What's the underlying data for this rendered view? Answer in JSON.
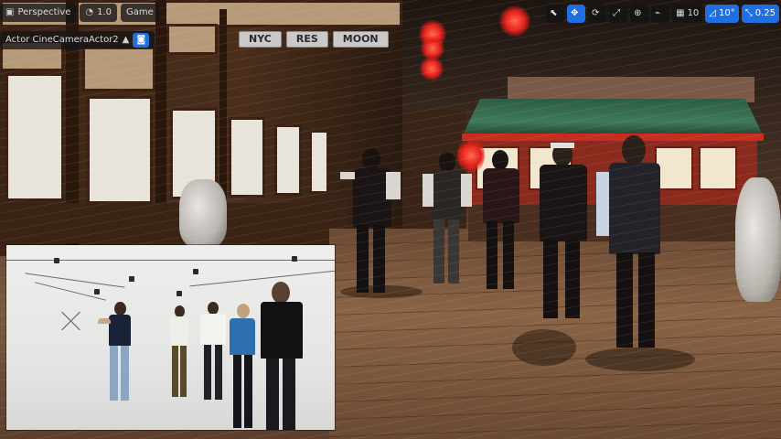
{
  "toolbar": {
    "view_mode_label": "Perspective",
    "camera_speed_label": "1.0",
    "lighting_label": "Game",
    "actor_label": "Actor CineCameraActor2",
    "right_tools": [
      {
        "name": "select-icon",
        "glyph": "⬉",
        "active": false,
        "value": ""
      },
      {
        "name": "translate-icon",
        "glyph": "✥",
        "active": true,
        "value": ""
      },
      {
        "name": "rotate-icon",
        "glyph": "⟳",
        "active": false,
        "value": ""
      },
      {
        "name": "scale-icon",
        "glyph": "⤢",
        "active": false,
        "value": ""
      },
      {
        "name": "world-icon",
        "glyph": "⊕",
        "active": false,
        "value": ""
      },
      {
        "name": "surface-snap-icon",
        "glyph": "⌁",
        "active": false,
        "value": ""
      },
      {
        "name": "grid-snap-icon",
        "glyph": "▦",
        "active": false,
        "value": "10"
      },
      {
        "name": "rotation-snap-icon",
        "glyph": "◿",
        "active": true,
        "value": "10°"
      },
      {
        "name": "scale-snap-icon",
        "glyph": "⤡",
        "active": true,
        "value": "0.25"
      }
    ]
  },
  "locations": {
    "buttons": [
      "NYC",
      "RES",
      "MOON"
    ]
  },
  "colors": {
    "accent": "#1f6fe0",
    "lamp": "#e21f1a"
  }
}
